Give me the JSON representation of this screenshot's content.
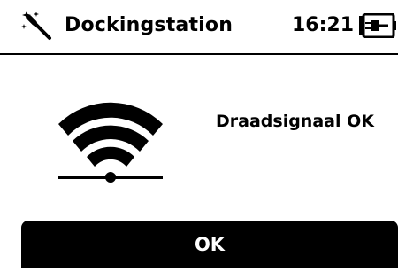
{
  "header": {
    "icon": "magic-wand-icon",
    "title": "Dockingstation",
    "time": "16:21",
    "battery_icon": "battery-plug-icon"
  },
  "main": {
    "signal_icon": "wifi-signal-icon",
    "status_text": "Draadsignaal OK"
  },
  "footer": {
    "ok_label": "OK"
  },
  "colors": {
    "foreground": "#000000",
    "background": "#ffffff",
    "button_text": "#ffffff"
  }
}
